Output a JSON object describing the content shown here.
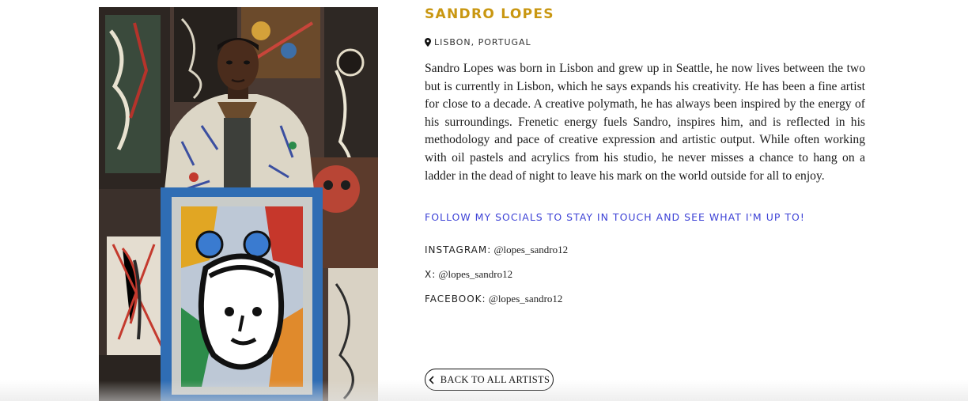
{
  "artist": {
    "name": "sandro lopes",
    "location": "lisbon, portugal",
    "bio": "Sandro Lopes was born in Lisbon and grew up in Seattle, he now lives between the two but is currently in Lisbon, which he says expands his creativity. He has been a fine artist for close to a decade. A creative polymath, he has always been inspired by the energy of his surroundings. Frenetic energy fuels Sandro, inspires him, and is reflected in his methodology and pace of creative expression and artistic output. While often working with oil pastels and acrylics from his studio, he never misses a chance to hang on a ladder in the dead of night to leave his mark on the world outside for all to enjoy."
  },
  "socials": {
    "intro": "follow my socials to stay in touch and see what i'm up to!",
    "items": [
      {
        "platform": "instagram:",
        "handle": "@lopes_sandro12"
      },
      {
        "platform": "x:",
        "handle": "@lopes_sandro12"
      },
      {
        "platform": "facebook:",
        "handle": "@lopes_sandro12"
      }
    ]
  },
  "nav": {
    "back_label": "back to all artists"
  },
  "icons": {
    "location": "map-pin-icon",
    "back": "chevron-left-icon"
  },
  "colors": {
    "name_accent": "#c99711",
    "link_accent": "#3e43d6"
  }
}
